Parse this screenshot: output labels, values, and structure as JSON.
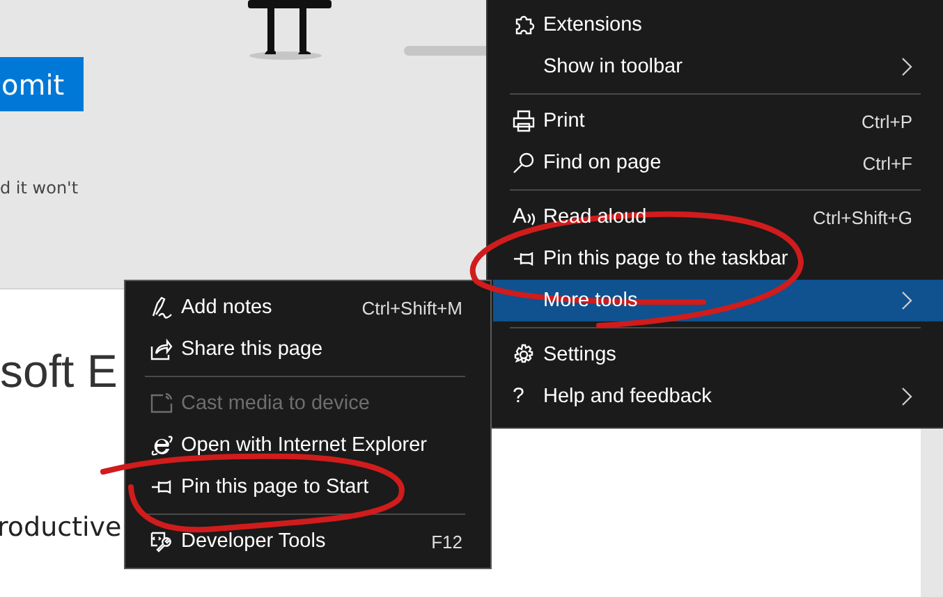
{
  "page": {
    "submit_button": "omit",
    "body_text": "d it won't",
    "heading": "soft E",
    "paragraph": "roductive"
  },
  "main_menu": {
    "items": [
      {
        "kind": "item",
        "label": "Extensions",
        "submenu": false,
        "selected": false
      },
      {
        "kind": "item",
        "label": "Show in toolbar",
        "submenu": true,
        "selected": false
      },
      {
        "kind": "separator"
      },
      {
        "kind": "item",
        "label": "Print",
        "shortcut": "Ctrl+P",
        "submenu": false,
        "selected": false
      },
      {
        "kind": "item",
        "label": "Find on page",
        "shortcut": "Ctrl+F",
        "submenu": false,
        "selected": false
      },
      {
        "kind": "separator"
      },
      {
        "kind": "item",
        "glyph": "A",
        "label": "Read aloud",
        "shortcut": "Ctrl+Shift+G",
        "submenu": false,
        "selected": false
      },
      {
        "kind": "item",
        "label": "Pin this page to the taskbar",
        "submenu": false,
        "selected": false
      },
      {
        "kind": "item",
        "label": "More tools",
        "submenu": true,
        "selected": true
      },
      {
        "kind": "separator"
      },
      {
        "kind": "item",
        "label": "Settings",
        "submenu": false,
        "selected": false
      },
      {
        "kind": "item",
        "glyph": "?",
        "label": "Help and feedback",
        "submenu": true,
        "selected": false
      }
    ]
  },
  "more_tools_menu": {
    "items": [
      {
        "kind": "item",
        "label": "Add notes",
        "shortcut": "Ctrl+Shift+M",
        "disabled": false
      },
      {
        "kind": "item",
        "label": "Share this page",
        "disabled": false
      },
      {
        "kind": "separator"
      },
      {
        "kind": "item",
        "label": "Cast media to device",
        "disabled": true
      },
      {
        "kind": "item",
        "label": "Open with Internet Explorer",
        "disabled": false
      },
      {
        "kind": "item",
        "label": "Pin this page to Start",
        "disabled": false
      },
      {
        "kind": "separator"
      },
      {
        "kind": "item",
        "label": "Developer Tools",
        "shortcut": "F12",
        "disabled": false
      }
    ]
  }
}
